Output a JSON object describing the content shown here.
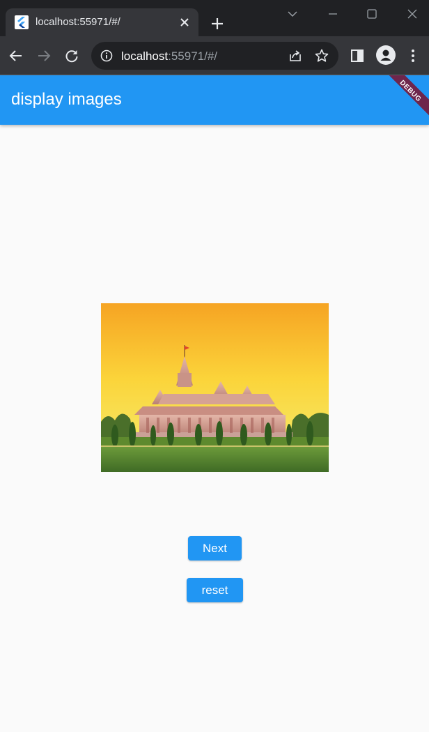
{
  "browser": {
    "tab": {
      "title": "localhost:55971/#/"
    },
    "address": {
      "host": "localhost",
      "rest": ":55971/#/"
    }
  },
  "app": {
    "title": "display images",
    "debug_banner": "DEBUG",
    "colors": {
      "primary": "#2196f3",
      "background": "#fafafa",
      "banner": "#880014"
    }
  },
  "image": {
    "subject": "temple-photo"
  },
  "buttons": {
    "next": "Next",
    "reset": "reset"
  },
  "icons": [
    "flutter-favicon-icon",
    "close-icon",
    "plus-icon",
    "chevron-down-icon",
    "minimize-icon",
    "maximize-icon",
    "window-close-icon",
    "back-arrow-icon",
    "forward-arrow-icon",
    "reload-icon",
    "info-icon",
    "share-icon",
    "star-icon",
    "side-panel-icon",
    "profile-icon",
    "kebab-menu-icon"
  ]
}
